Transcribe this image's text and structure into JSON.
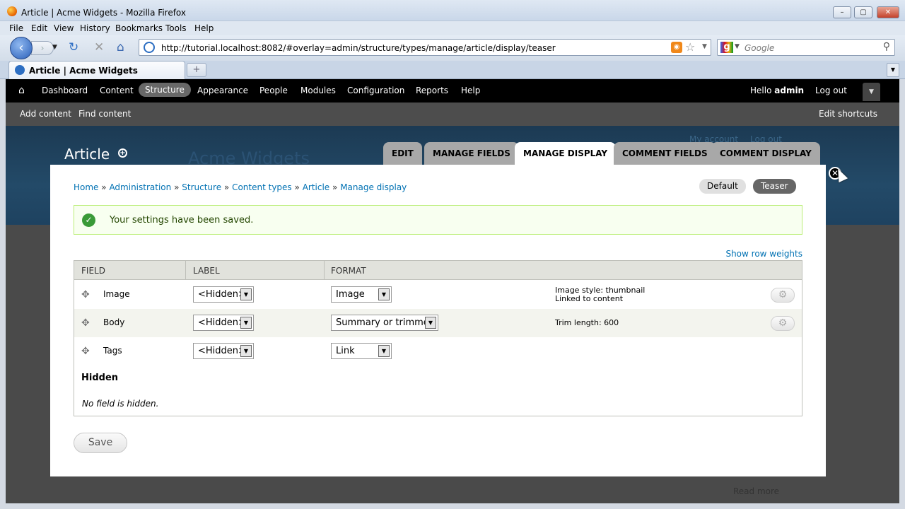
{
  "window": {
    "title": "Article | Acme Widgets - Mozilla Firefox",
    "minimize": "–",
    "maximize": "▢",
    "close": "✕"
  },
  "menu": [
    "File",
    "Edit",
    "View",
    "History",
    "Bookmarks",
    "Tools",
    "Help"
  ],
  "nav": {
    "url": "http://tutorial.localhost:8082/#overlay=admin/structure/types/manage/article/display/teaser",
    "search_placeholder": "Google",
    "icons": [
      "back-icon",
      "forward-icon",
      "reload-icon",
      "stop-icon",
      "home-icon",
      "rss-icon",
      "bookmark-star-icon",
      "search-icon"
    ]
  },
  "tab": {
    "label": "Article | Acme Widgets",
    "new_tab": "+"
  },
  "toolbar": {
    "items": [
      "Dashboard",
      "Content",
      "Structure",
      "Appearance",
      "People",
      "Modules",
      "Configuration",
      "Reports",
      "Help"
    ],
    "active": "Structure",
    "hello": "Hello",
    "user": "admin",
    "logout": "Log out"
  },
  "shortcuts": {
    "items": [
      "Add content",
      "Find content"
    ],
    "edit": "Edit shortcuts"
  },
  "site": {
    "name": "Acme Widgets",
    "ghost_links": [
      "My account",
      "Log out"
    ],
    "read_more": "Read more"
  },
  "overlay": {
    "title": "Article",
    "tabs": [
      "EDIT",
      "MANAGE FIELDS",
      "MANAGE DISPLAY",
      "COMMENT FIELDS",
      "COMMENT DISPLAY"
    ],
    "active_tab": "MANAGE DISPLAY",
    "breadcrumb": [
      "Home",
      "Administration",
      "Structure",
      "Content types",
      "Article",
      "Manage display"
    ],
    "breadcrumb_sep": "»",
    "view_modes": [
      "Default",
      "Teaser"
    ],
    "active_view_mode": "Teaser",
    "status_message": "Your settings have been saved.",
    "row_weights_link": "Show row weights",
    "table": {
      "headers": [
        "FIELD",
        "LABEL",
        "FORMAT"
      ],
      "rows": [
        {
          "field": "Image",
          "label": "<Hidden>",
          "format": "Image",
          "summary_1": "Image style: thumbnail",
          "summary_2": "Linked to content",
          "has_settings": true
        },
        {
          "field": "Body",
          "label": "<Hidden>",
          "format": "Summary or trimmed",
          "summary_1": "Trim length: 600",
          "summary_2": "",
          "has_settings": true
        },
        {
          "field": "Tags",
          "label": "<Hidden>",
          "format": "Link",
          "summary_1": "",
          "summary_2": "",
          "has_settings": false
        }
      ],
      "hidden_heading": "Hidden",
      "no_hidden": "No field is hidden."
    },
    "save_label": "Save"
  },
  "colors": {
    "toolbar_bg": "#000000",
    "link": "#0071b3",
    "status_bg": "#f8fff0",
    "status_ok": "#3a9a38",
    "header_bg": "#1c3a53"
  }
}
